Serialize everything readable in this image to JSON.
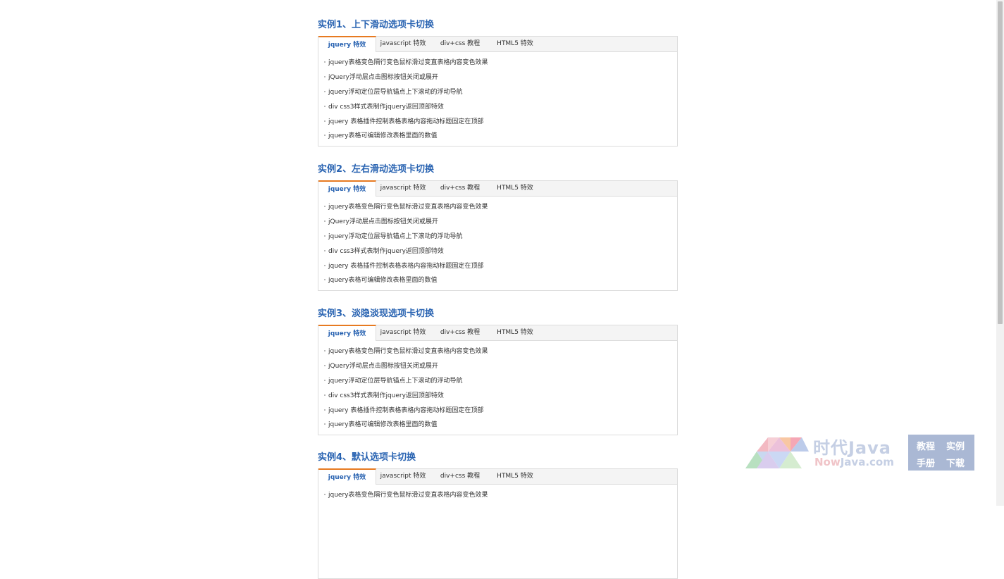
{
  "examples": [
    {
      "title": "实例1、上下滑动选项卡切换",
      "tabs": [
        "jquery 特效",
        "javascript 特效",
        "div+css 教程",
        "HTML5 特效"
      ],
      "items": [
        "jquery表格变色隔行变色鼠标滑过变直表格内容变色效果",
        "jQuery浮动层点击图标按钮关闭或展开",
        "jquery浮动定位层导航锚点上下滚动的浮动导航",
        "div css3样式表制作jquery返回顶部特效",
        "jquery 表格插件控制表格表格内容拖动标题固定在顶部",
        "jquery表格可编辑修改表格里面的数值"
      ]
    },
    {
      "title": "实例2、左右滑动选项卡切换",
      "tabs": [
        "jquery 特效",
        "javascript 特效",
        "div+css 教程",
        "HTML5 特效"
      ],
      "items": [
        "jquery表格变色隔行变色鼠标滑过变直表格内容变色效果",
        "jQuery浮动层点击图标按钮关闭或展开",
        "jquery浮动定位层导航锚点上下滚动的浮动导航",
        "div css3样式表制作jquery返回顶部特效",
        "jquery 表格插件控制表格表格内容拖动标题固定在顶部",
        "jquery表格可编辑修改表格里面的数值"
      ]
    },
    {
      "title": "实例3、淡隐淡现选项卡切换",
      "tabs": [
        "jquery 特效",
        "javascript 特效",
        "div+css 教程",
        "HTML5 特效"
      ],
      "items": [
        "jquery表格变色隔行变色鼠标滑过变直表格内容变色效果",
        "jQuery浮动层点击图标按钮关闭或展开",
        "jquery浮动定位层导航锚点上下滚动的浮动导航",
        "div css3样式表制作jquery返回顶部特效",
        "jquery 表格插件控制表格表格内容拖动标题固定在顶部",
        "jquery表格可编辑修改表格里面的数值"
      ]
    },
    {
      "title": "实例4、默认选项卡切换",
      "tabs": [
        "jquery 特效",
        "javascript 特效",
        "div+css 教程",
        "HTML5 特效"
      ],
      "items": [
        "jquery表格变色隔行变色鼠标滑过变直表格内容变色效果"
      ]
    }
  ],
  "watermark": {
    "title": "时代Java",
    "domain_prefix": "Now",
    "domain_rest": "Java.com",
    "box": [
      "教程",
      "实例",
      "手册",
      "下载"
    ]
  },
  "colors": {
    "title": "#2a64b2",
    "tab_accent": "#e77a21",
    "border": "#dcdcdc"
  }
}
